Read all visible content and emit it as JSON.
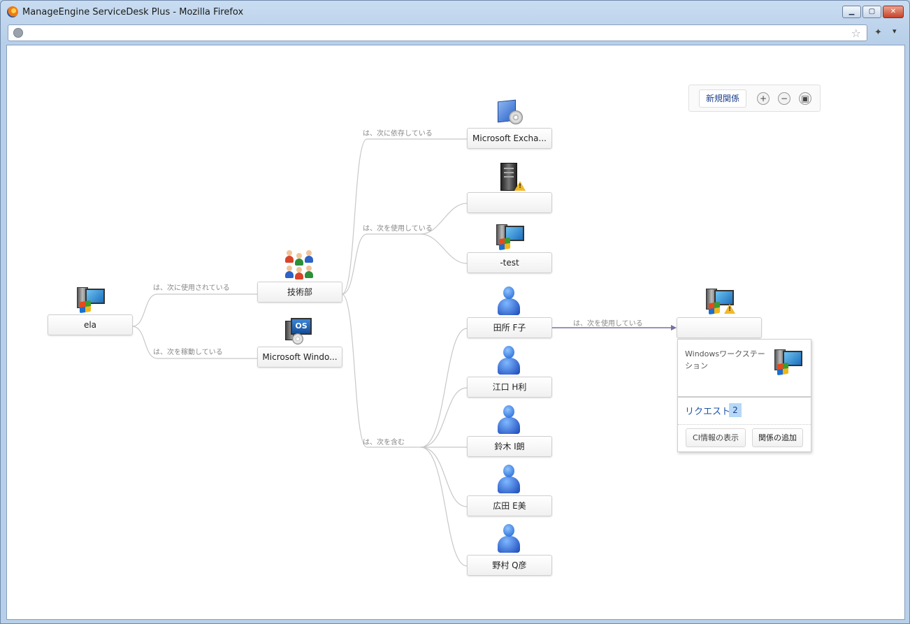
{
  "window": {
    "title": "ManageEngine ServiceDesk Plus - Mozilla Firefox",
    "minimize_glyph": "▁",
    "maximize_glyph": "▢",
    "close_glyph": "✕"
  },
  "browser": {
    "url": "",
    "star_glyph": "☆",
    "tool_glyph": "✦",
    "menu_glyph": "▾"
  },
  "toolbar": {
    "new_relation_label": "新規関係",
    "zoom_in_glyph": "+",
    "zoom_out_glyph": "−",
    "zoom_fit_glyph": "▣"
  },
  "nodes": {
    "ela": "ela",
    "dept": "技術部",
    "os": "Microsoft Windo...",
    "exchange": "Microsoft Excha...",
    "server": "",
    "test": "-test",
    "user1": "田所 F子",
    "user2": "江口 H利",
    "user3": "鈴木 I朗",
    "user4": "広田 E美",
    "user5": "野村 Q彦",
    "laptop": ""
  },
  "edge_labels": {
    "used_by": "は、次に使用されている",
    "runs": "は、次を稼動している",
    "depends": "は、次に依存している",
    "uses": "は、次を使用している",
    "contains": "は、次を含む",
    "uses2": "は、次を使用している"
  },
  "popup": {
    "type": "Windowsワークステーション",
    "name": "",
    "requests_label": "リクエスト",
    "requests_count": "2",
    "show_ci_label": "CI情報の表示",
    "add_relation_label": "関係の追加"
  },
  "colors": {
    "link": "#c8c8c8",
    "active_link": "#7a6fa0",
    "accent": "#1b53a8"
  }
}
